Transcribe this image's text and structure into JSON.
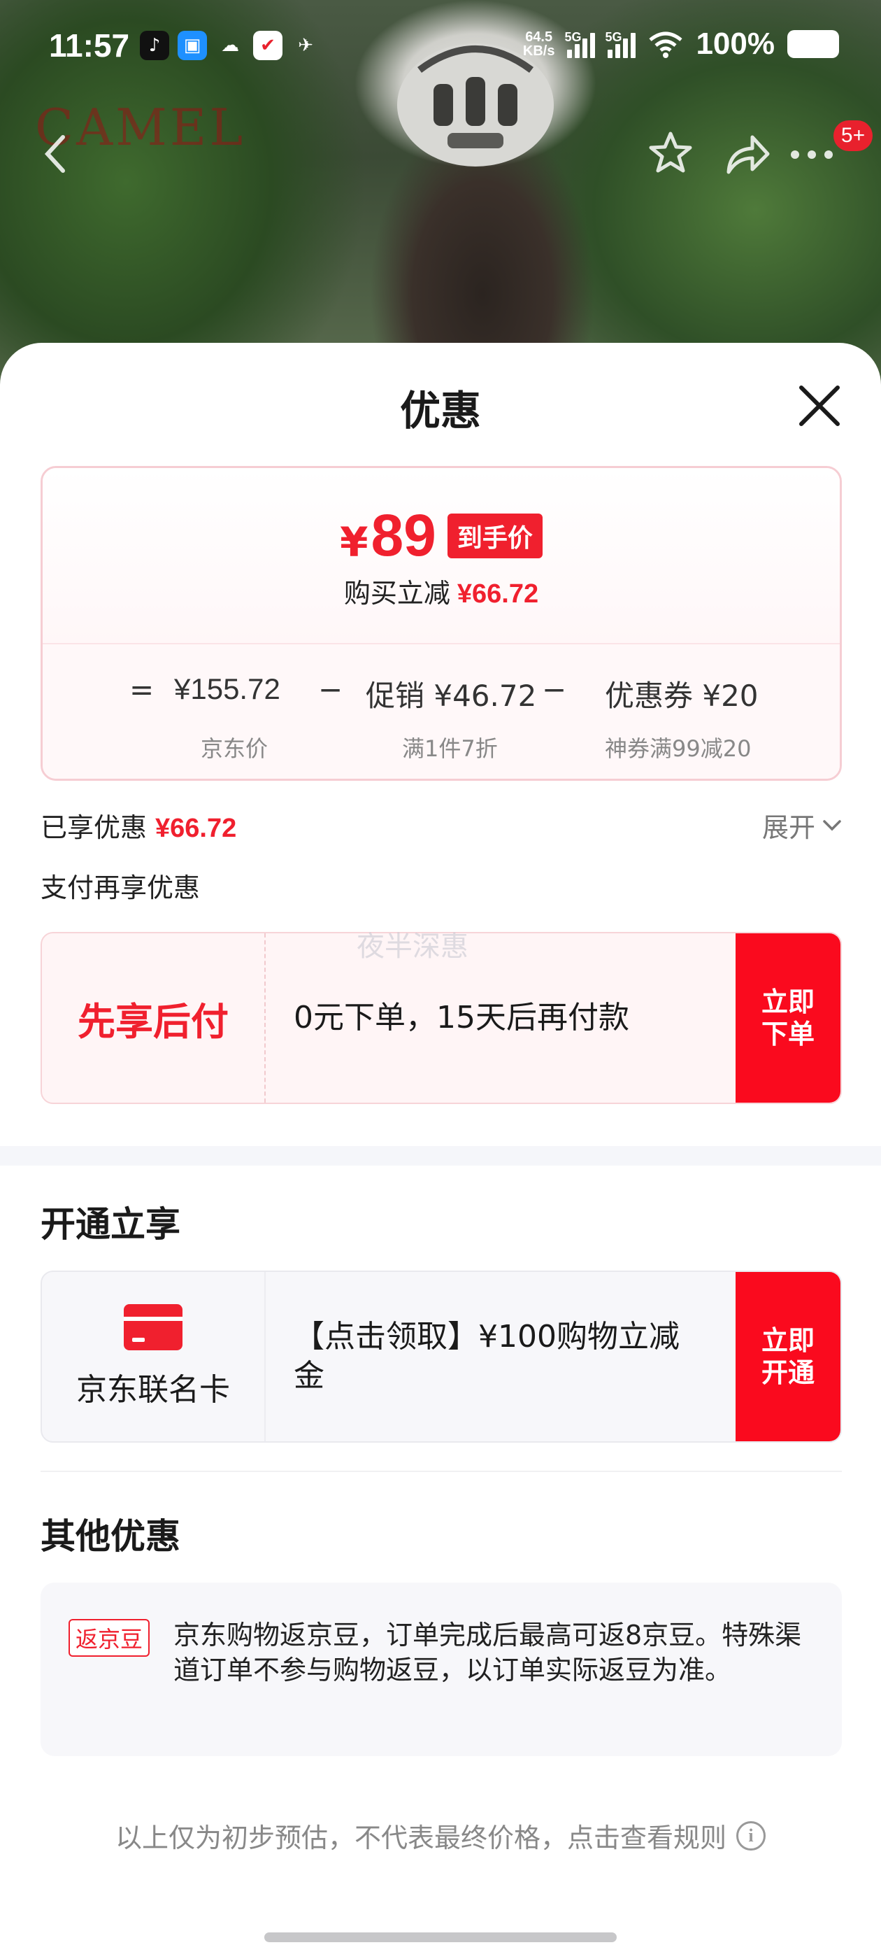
{
  "status_bar": {
    "time": "11:57",
    "net_speed_value": "64.5",
    "net_speed_unit": "KB/s",
    "signal1_tag": "5G",
    "signal2_tag": "5G",
    "battery": "100%"
  },
  "background": {
    "brand_watermark": "CAMEL"
  },
  "nav": {
    "badge": "5+"
  },
  "sheet": {
    "title": "优惠",
    "price": {
      "currency": "¥",
      "value": "89",
      "tag": "到手价",
      "reduction_label": "购买立减",
      "reduction_value": "¥66.72"
    },
    "formula": {
      "equals": "=",
      "jd_price": "¥155.72",
      "minus1": "−",
      "promo": "促销 ¥46.72",
      "minus2": "−",
      "coupon": "优惠券 ¥20",
      "jd_price_label": "京东价",
      "promo_label": "满1件7折",
      "coupon_label": "神券满99减20"
    },
    "enjoyed_label": "已享优惠",
    "enjoyed_value": "¥66.72",
    "expand_label": "展开",
    "pay_more_label": "支付再享优惠",
    "faint_watermark": "夜半深惠",
    "bnpl": {
      "title": "先享后付",
      "desc": "0元下单，15天后再付款",
      "action": "立即\n下单"
    },
    "open_section_title": "开通立享",
    "card_offer": {
      "title": "京东联名卡",
      "desc": "【点击领取】¥100购物立减金",
      "action": "立即\n开通"
    },
    "other_section_title": "其他优惠",
    "bean": {
      "tag": "返京豆",
      "text": "京东购物返京豆，订单完成后最高可返8京豆。特殊渠道订单不参与购物返豆，以订单实际返豆为准。"
    },
    "disclaimer": "以上仅为初步预估，不代表最终价格，点击查看规则"
  },
  "colors": {
    "accent_red": "#f0202e",
    "action_red": "#fa0a1e"
  }
}
